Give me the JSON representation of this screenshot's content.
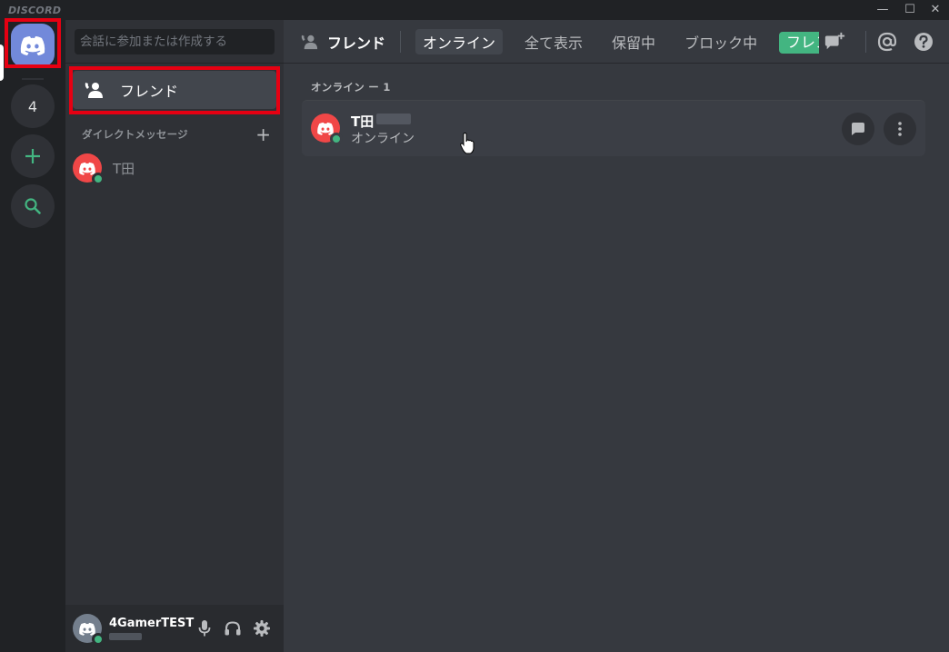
{
  "window": {
    "brand": "DISCORD",
    "minimize": "—",
    "maximize": "☐",
    "close": "✕"
  },
  "rail": {
    "home_icon": "discord-logo-icon",
    "unread_count": "4",
    "add_server_icon": "plus-icon",
    "explore_icon": "search-icon"
  },
  "sidebar": {
    "search_placeholder": "会話に参加または作成する",
    "friends_label": "フレンド",
    "dm_header": "ダイレクトメッセージ",
    "dm_add": "+",
    "dms": [
      {
        "name": "T田"
      }
    ]
  },
  "user": {
    "name": "4GamerTEST"
  },
  "topbar": {
    "title": "フレンド",
    "tabs": [
      "オンライン",
      "全て表示",
      "保留中",
      "ブロック中"
    ],
    "add_friend": "フレンドに追加"
  },
  "main": {
    "online_header": "オンライン ー 1",
    "friends": [
      {
        "name": "T田",
        "status": "オンライン"
      }
    ]
  },
  "colors": {
    "blurple": "#7289da",
    "green": "#43b581",
    "red_highlight": "#e60012",
    "avatar_red": "#f04747"
  }
}
